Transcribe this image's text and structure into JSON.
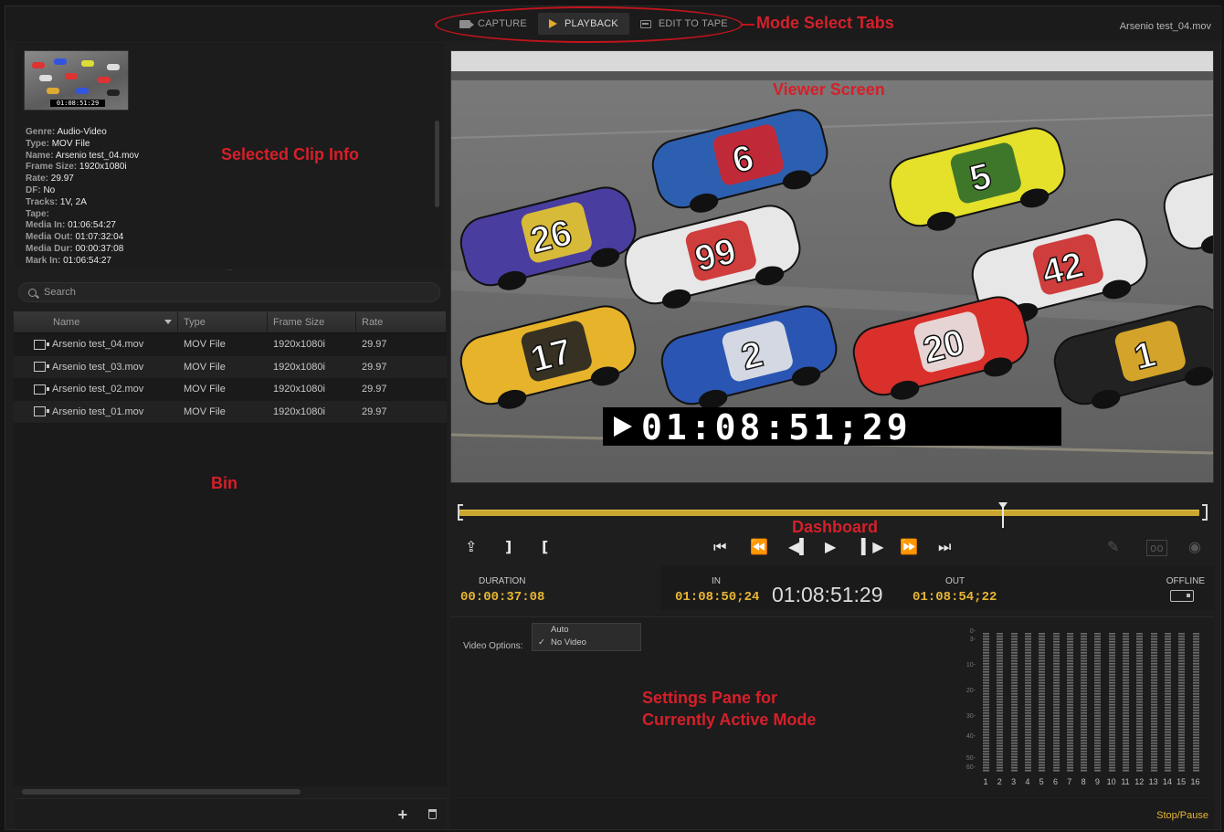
{
  "window": {
    "file_title": "Arsenio test_04.mov"
  },
  "tabs": [
    {
      "label": "CAPTURE",
      "icon": "camera-icon"
    },
    {
      "label": "PLAYBACK",
      "icon": "play-icon",
      "active": true
    },
    {
      "label": "EDIT TO TAPE",
      "icon": "tape-icon"
    }
  ],
  "annotations": {
    "mode_tabs": "Mode Select Tabs",
    "viewer": "Viewer Screen",
    "clip_info": "Selected Clip Info",
    "bin": "Bin",
    "dashboard": "Dashboard",
    "settings_line1": "Settings Pane for",
    "settings_line2": "Currently Active Mode"
  },
  "clip_info": [
    {
      "key": "Genre:",
      "value": "Audio-Video"
    },
    {
      "key": "Type:",
      "value": "MOV File"
    },
    {
      "key": "Name:",
      "value": "Arsenio test_04.mov"
    },
    {
      "key": "Frame Size:",
      "value": "1920x1080i"
    },
    {
      "key": "Rate:",
      "value": "29.97"
    },
    {
      "key": "DF:",
      "value": "No"
    },
    {
      "key": "Tracks:",
      "value": "1V, 2A"
    },
    {
      "key": "Tape:",
      "value": ""
    },
    {
      "key": "Media In:",
      "value": "01:06:54:27"
    },
    {
      "key": "Media Out:",
      "value": "01:07:32:04"
    },
    {
      "key": "Media Dur:",
      "value": "00:00:37:08"
    },
    {
      "key": "Mark In:",
      "value": "01:06:54:27"
    }
  ],
  "thumbnail_timecode": "01:08:51:29",
  "search": {
    "placeholder": "Search"
  },
  "bin": {
    "columns": [
      "Name",
      "Type",
      "Frame Size",
      "Rate"
    ],
    "rows": [
      {
        "name": "Arsenio test_04.mov",
        "type": "MOV File",
        "frame": "1920x1080i",
        "rate": "29.97"
      },
      {
        "name": "Arsenio test_03.mov",
        "type": "MOV File",
        "frame": "1920x1080i",
        "rate": "29.97"
      },
      {
        "name": "Arsenio test_02.mov",
        "type": "MOV File",
        "frame": "1920x1080i",
        "rate": "29.97"
      },
      {
        "name": "Arsenio test_01.mov",
        "type": "MOV File",
        "frame": "1920x1080i",
        "rate": "29.97"
      }
    ]
  },
  "viewer": {
    "burned_timecode": "01:08:51;29",
    "car_numbers": [
      "6",
      "5",
      "26",
      "99",
      "42",
      "17",
      "2",
      "20",
      "1"
    ]
  },
  "dashboard": {
    "playhead_fraction": 0.735,
    "duration_label": "DURATION",
    "duration": "00:00:37:08",
    "in_label": "IN",
    "in": "01:08:50;24",
    "current": "01:08:51:29",
    "out_label": "OUT",
    "out": "01:08:54;22",
    "offline_label": "OFFLINE"
  },
  "settings": {
    "video_options_label": "Video Options:",
    "options": [
      "Auto",
      "No Video"
    ],
    "selected": "No Video",
    "meter_scale": [
      "0-",
      "3-",
      "10-",
      "20-",
      "30-",
      "40-",
      "50-",
      "60-"
    ],
    "channels": [
      "1",
      "2",
      "3",
      "4",
      "5",
      "6",
      "7",
      "8",
      "9",
      "10",
      "11",
      "12",
      "13",
      "14",
      "15",
      "16"
    ]
  },
  "status": {
    "stop_pause": "Stop/Pause"
  },
  "colors": {
    "accent": "#e7b634",
    "annotation": "#d4202a",
    "scrub": "#c9a630"
  }
}
